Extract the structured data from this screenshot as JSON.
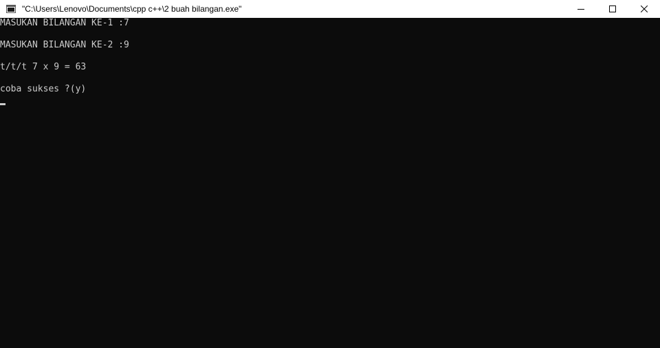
{
  "window": {
    "title": "\"C:\\Users\\Lenovo\\Documents\\cpp c++\\2 buah bilangan.exe\"",
    "icon": "console-app-icon",
    "controls": [
      "minimize-icon",
      "maximize-icon",
      "close-icon"
    ]
  },
  "console": {
    "lines": [
      "MASUKAN BILANGAN KE-1 :7",
      "MASUKAN BILANGAN KE-2 :9",
      "t/t/t 7 x 9 = 63",
      "coba sukses ?(y)"
    ],
    "colors": {
      "background": "#0c0c0c",
      "foreground": "#cccccc"
    }
  }
}
